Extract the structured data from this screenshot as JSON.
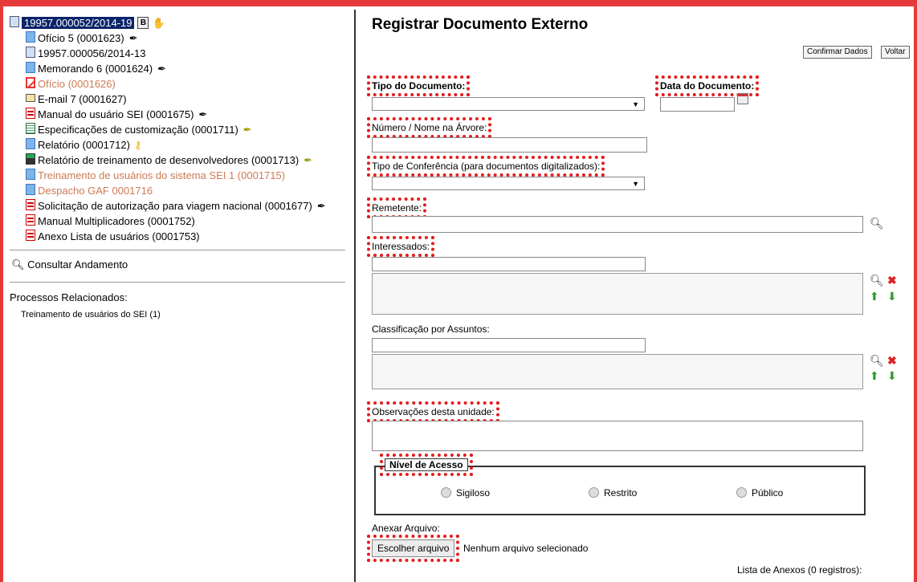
{
  "tree": {
    "root": "19957.000052/2014-19",
    "root_badge": "B",
    "items": [
      {
        "label": "Ofício 5 (0001623)",
        "icon": "document-icon",
        "faded": false,
        "pen": true,
        "pen_color": "black"
      },
      {
        "label": "19957.000056/2014-13",
        "icon": "process-icon",
        "faded": false,
        "pen": false
      },
      {
        "label": "Memorando 6 (0001624)",
        "icon": "document-icon",
        "faded": false,
        "pen": true,
        "pen_color": "black"
      },
      {
        "label": "Ofício (0001626)",
        "icon": "cancelled-icon",
        "faded": true,
        "pen": false
      },
      {
        "label": "E-mail 7 (0001627)",
        "icon": "email-icon",
        "faded": false,
        "pen": false
      },
      {
        "label": "Manual do usuário SEI (0001675)",
        "icon": "pdf-icon",
        "faded": false,
        "pen": true,
        "pen_color": "black"
      },
      {
        "label": "Especificações de customização (0001711)",
        "icon": "spreadsheet-icon",
        "faded": false,
        "pen": true,
        "pen_color": "gold"
      },
      {
        "label": "Relatório (0001712)",
        "icon": "document-icon",
        "faded": false,
        "pen": false,
        "key": true
      },
      {
        "label": "Relatório de treinamento de desenvolvedores (0001713)",
        "icon": "report-icon",
        "faded": false,
        "pen": true,
        "pen_color": "gold"
      },
      {
        "label": "Treinamento de usuários do sistema SEI 1 (0001715)",
        "icon": "document-icon",
        "faded": true,
        "pen": false
      },
      {
        "label": "Despacho GAF 0001716",
        "icon": "document-icon",
        "faded": true,
        "pen": false
      },
      {
        "label": "Solicitação de autorização para viagem nacional (0001677)",
        "icon": "pdf-icon",
        "faded": false,
        "pen": true,
        "pen_color": "black"
      },
      {
        "label": "Manual Multiplicadores (0001752)",
        "icon": "pdf-icon",
        "faded": false,
        "pen": false
      },
      {
        "label": "Anexo Lista de usuários (0001753)",
        "icon": "pdf-icon",
        "faded": false,
        "pen": false
      }
    ]
  },
  "consultar": "Consultar Andamento",
  "related": {
    "title": "Processos Relacionados:",
    "items": [
      "Treinamento de usuários do SEI (1)"
    ]
  },
  "form": {
    "title": "Registrar Documento Externo",
    "confirm_button": "Confirmar Dados",
    "back_button": "Voltar",
    "tipo_documento_label": "Tipo do Documento:",
    "data_documento_label": "Data do Documento:",
    "numero_label": "Número / Nome na Árvore:",
    "tipo_conferencia_label": "Tipo de Conferência (para documentos digitalizados):",
    "remetente_label": "Remetente:",
    "interessados_label": "Interessados:",
    "classificacao_label": "Classificação por Assuntos:",
    "observacoes_label": "Observações desta unidade:",
    "nivel_acesso_legend": "Nível de Acesso",
    "access_options": [
      "Sigiloso",
      "Restrito",
      "Público"
    ],
    "anexar_label": "Anexar Arquivo:",
    "file_button": "Escolher arquivo",
    "file_status": "Nenhum arquivo selecionado",
    "anexos_list": "Lista de Anexos (0 registros):"
  },
  "colors": {
    "frame": "#e43a3a",
    "highlight": "#e31c1c",
    "faded_text": "#cc7a55",
    "selected_bg": "#0a246a"
  }
}
